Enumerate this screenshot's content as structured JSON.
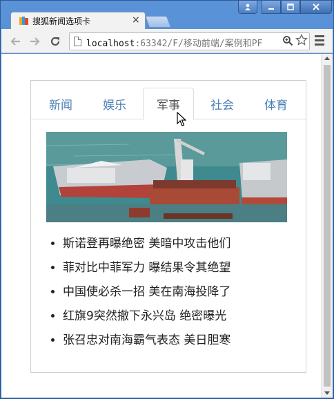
{
  "browser": {
    "tab_title": "搜狐新闻选项卡",
    "tab_close": "×",
    "url_host": "localhost",
    "url_rest": ":63342/F/移动前端/案例和PF",
    "window_controls": {
      "user": "user-icon",
      "minimize": "minimize-icon",
      "maximize": "maximize-icon",
      "close": "close-icon"
    }
  },
  "page": {
    "tabs": [
      {
        "label": "新闻",
        "active": false
      },
      {
        "label": "娱乐",
        "active": false
      },
      {
        "label": "军事",
        "active": true
      },
      {
        "label": "社会",
        "active": false
      },
      {
        "label": "体育",
        "active": false
      }
    ],
    "image_subject": "ships-at-shipyard",
    "news": [
      "斯诺登再曝绝密 美暗中攻击他们",
      "菲对比中菲军力 曝结果令其绝望",
      "中国使必杀一招 美在南海投降了",
      "红旗9突然撤下永兴岛 绝密曝光",
      "张召忠对南海霸气表态 美日胆寒"
    ]
  },
  "colors": {
    "tab_link": "#4a7eb5",
    "tab_active_text": "#555555",
    "titlebar": "#4a7fc3"
  }
}
